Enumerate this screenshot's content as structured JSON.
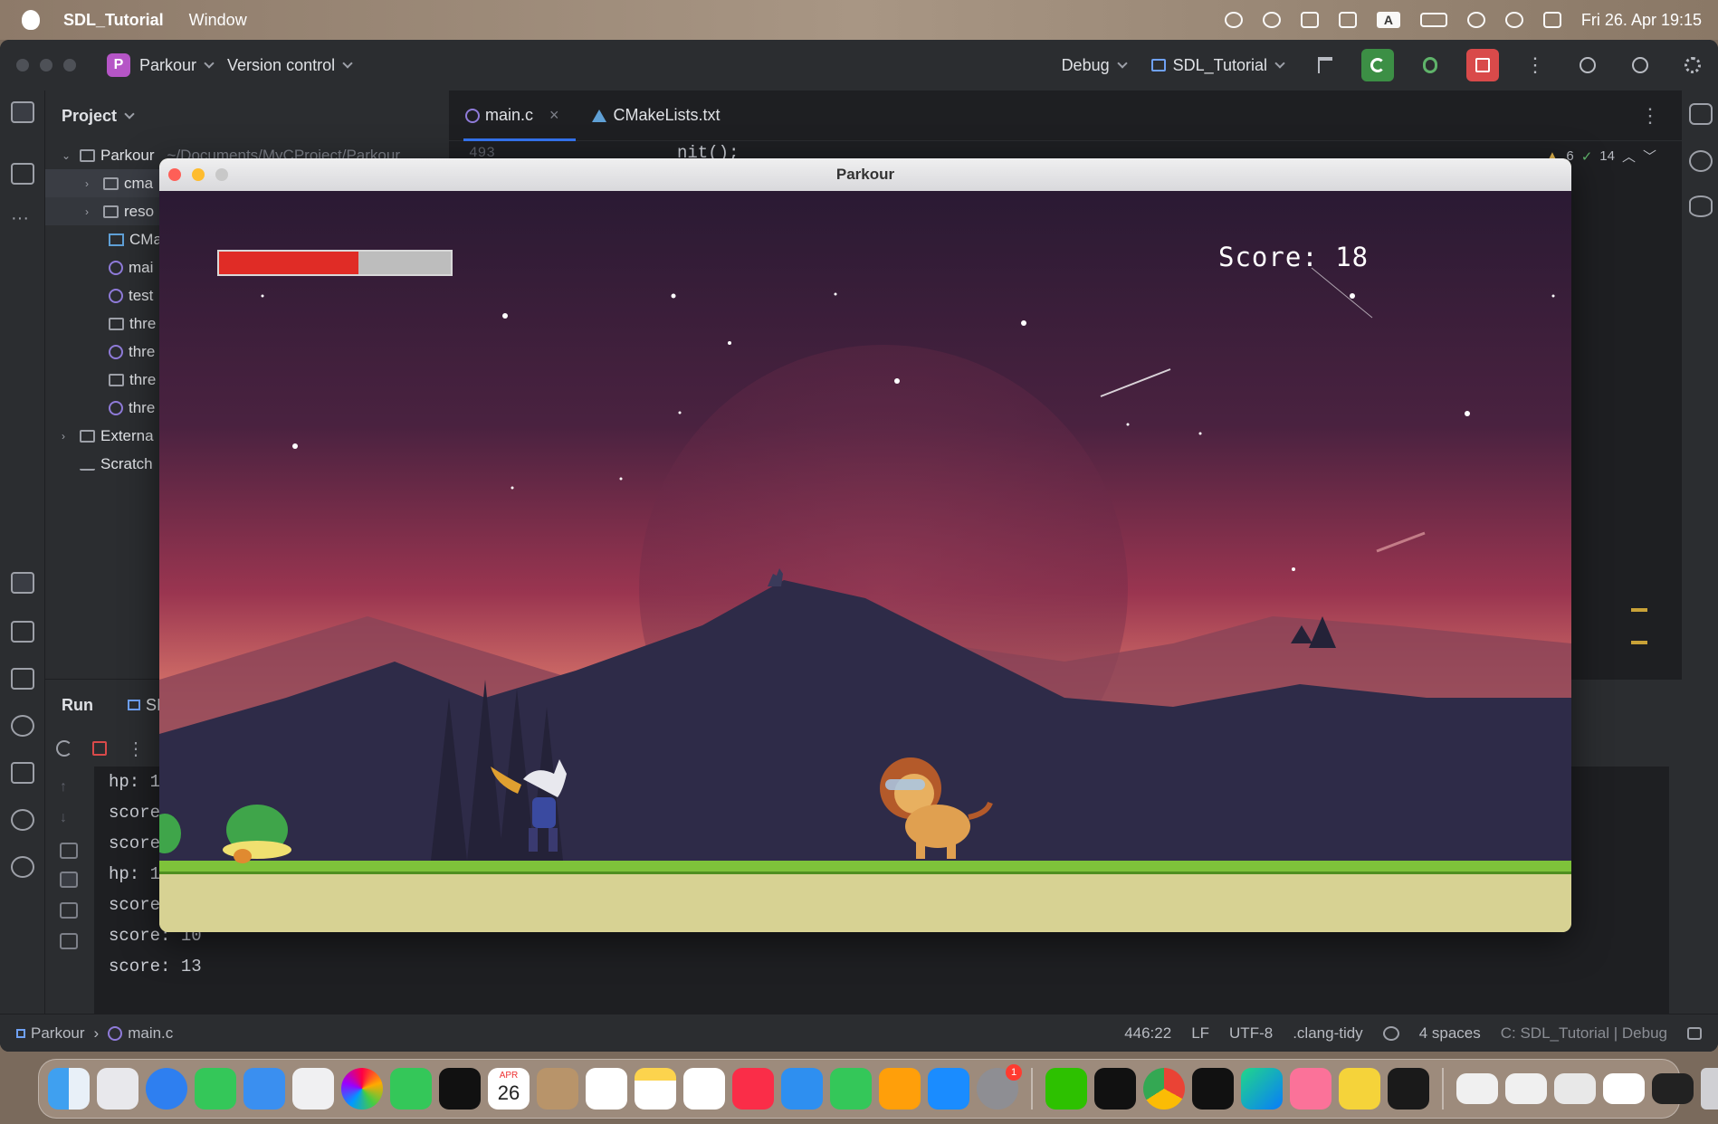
{
  "menubar": {
    "app_name": "SDL_Tutorial",
    "menu_window": "Window",
    "datetime": "Fri 26. Apr  19:15",
    "input_letter": "A"
  },
  "ide": {
    "project_badge": "P",
    "project_name": "Parkour",
    "vcs": "Version control",
    "config": "Debug",
    "run_target": "SDL_Tutorial",
    "project_panel_title": "Project",
    "tree": [
      {
        "label": "Parkour",
        "suffix": "~/Documents/MyCProject/Parkour"
      },
      {
        "label": "cma"
      },
      {
        "label": "reso"
      },
      {
        "label": "CMa"
      },
      {
        "label": "mai"
      },
      {
        "label": "test"
      },
      {
        "label": "thre"
      },
      {
        "label": "thre"
      },
      {
        "label": "thre"
      },
      {
        "label": "thre"
      },
      {
        "label": "Externa"
      },
      {
        "label": "Scratch"
      }
    ],
    "tabs": [
      {
        "label": "main.c"
      },
      {
        "label": "CMakeLists.txt"
      }
    ],
    "line_number": "493",
    "code_snippet": "nit();",
    "warnings": "6",
    "checks": "14",
    "run_title": "Run",
    "run_config_tab": "SI",
    "console": [
      "hp: 1",
      "score",
      "score",
      "hp: 1",
      "score",
      "score: 10",
      "score: 13"
    ],
    "status": {
      "breadcrumb_project": "Parkour",
      "breadcrumb_file": "main.c",
      "position": "446:22",
      "line_sep": "LF",
      "encoding": "UTF-8",
      "linter": ".clang-tidy",
      "indent": "4 spaces",
      "context": "C: SDL_Tutorial | Debug"
    }
  },
  "game": {
    "window_title": "Parkour",
    "score_text": "Score: 18",
    "hp_fraction": 0.6,
    "colors": {
      "hp": "#e02c26",
      "grass": "#7ec23a",
      "ground": "#d7d293"
    }
  },
  "dock": {
    "calendar_month": "APR",
    "calendar_day": "26",
    "notification_badge": "1"
  }
}
